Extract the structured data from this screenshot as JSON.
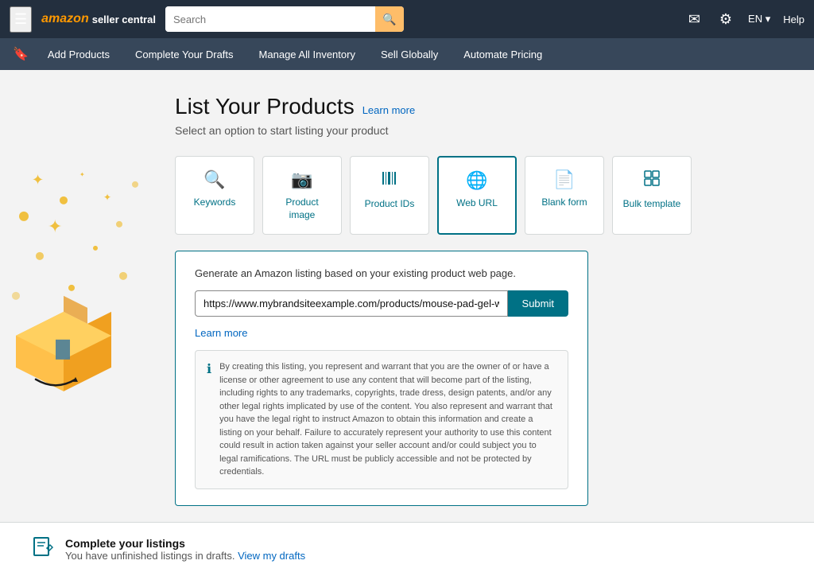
{
  "topnav": {
    "logo_amazon": "amazon",
    "logo_sub": "seller central",
    "search_placeholder": "Search",
    "search_btn_icon": "🔍",
    "mail_icon": "✉",
    "gear_icon": "⚙",
    "lang": "EN ▾",
    "help": "Help"
  },
  "secondnav": {
    "bookmark_icon": "🔖",
    "items": [
      {
        "label": "Add Products"
      },
      {
        "label": "Complete Your Drafts"
      },
      {
        "label": "Manage All Inventory"
      },
      {
        "label": "Sell Globally"
      },
      {
        "label": "Automate Pricing"
      }
    ]
  },
  "page": {
    "title": "List Your Products",
    "learn_more": "Learn more",
    "subtitle": "Select an option to start listing your product",
    "options": [
      {
        "icon": "🔍",
        "label": "Keywords"
      },
      {
        "icon": "📷",
        "label": "Product image"
      },
      {
        "icon": "|||",
        "label": "Product IDs"
      },
      {
        "icon": "🌐",
        "label": "Web URL"
      },
      {
        "icon": "📄",
        "label": "Blank form"
      },
      {
        "icon": "⊞",
        "label": "Bulk template"
      }
    ],
    "weburl": {
      "description": "Generate an Amazon listing based on your existing product web page.",
      "input_placeholder": "https://www.mybrandsiteexample.com/products/mouse-pad-gel-wrist-rest",
      "input_value": "https://www.mybrandsiteexample.com/products/mouse-pad-gel-wrist-rest",
      "learn_more": "Learn more",
      "submit_label": "Submit",
      "legal_text": "By creating this listing, you represent and warrant that you are the owner of or have a license or other agreement to use any content that will become part of the listing, including rights to any trademarks, copyrights, trade dress, design patents, and/or any other legal rights implicated by use of the content. You also represent and warrant that you have the legal right to instruct Amazon to obtain this information and create a listing on your behalf. Failure to accurately represent your authority to use this content could result in action taken against your seller account and/or could subject you to legal ramifications. The URL must be publicly accessible and not be protected by credentials."
    },
    "bottom_banner": {
      "title": "Complete your listings",
      "subtitle": "You have unfinished listings in drafts.",
      "link_text": "View my drafts"
    }
  }
}
